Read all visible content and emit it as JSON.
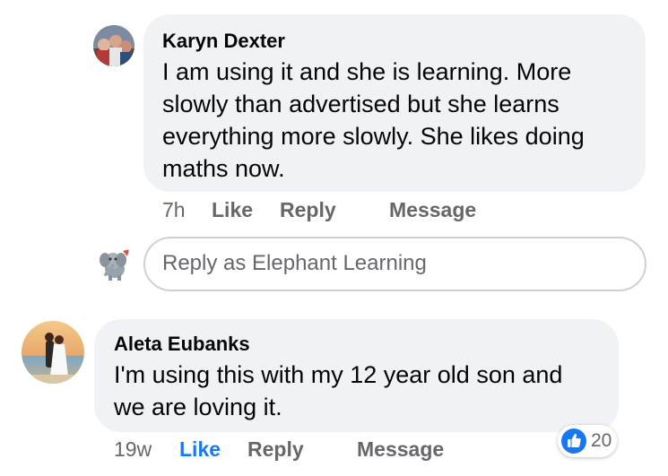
{
  "comments": [
    {
      "author": "Karyn Dexter",
      "text_lines": [
        "I am using it and she is learning. More",
        "slowly than advertised but she learns",
        "everything more slowly.  She likes doing",
        "maths now."
      ],
      "time": "7h",
      "like_label": "Like",
      "reply_label": "Reply",
      "message_label": "Message",
      "avatar_icon": "group-photo-avatar-icon"
    },
    {
      "author": "Aleta Eubanks",
      "text_lines": [
        "I'm using this with my 12 year old son and",
        "we are loving it."
      ],
      "time": "19w",
      "like_label": "Like",
      "reply_label": "Reply",
      "message_label": "Message",
      "reaction_count": "20",
      "avatar_icon": "wedding-photo-avatar-icon"
    }
  ],
  "reply_box": {
    "placeholder": "Reply as Elephant Learning",
    "page_avatar_icon": "elephant-logo-icon"
  },
  "colors": {
    "bubble_bg": "#f0f2f5",
    "like_active": "#1877f2",
    "meta_text": "#65676b",
    "border": "#ced0d4"
  }
}
